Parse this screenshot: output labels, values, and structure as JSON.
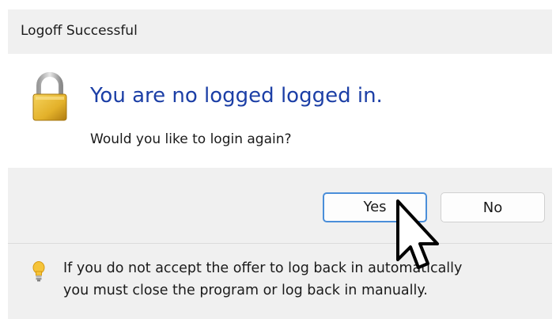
{
  "window": {
    "title": "Logoff Successful"
  },
  "message": {
    "main_instruction": "You are no logged logged in.",
    "content": "Would you like to login again?"
  },
  "buttons": {
    "yes_label": "Yes",
    "no_label": "No"
  },
  "footer": {
    "icon": "lightbulb-icon",
    "line1": "If you do not accept the offer to log back in automatically",
    "line2": "you must close the program or log back in manually."
  },
  "colors": {
    "main_instruction": "#1c3fa6",
    "default_button_border": "#4a8ed9",
    "lock_gold": "#e3b12a"
  }
}
